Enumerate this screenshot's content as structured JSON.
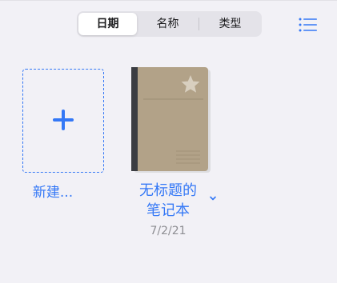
{
  "colors": {
    "background": "#f2f1f6",
    "accent": "#3478f6",
    "notebook_cover": "#b2a288",
    "notebook_spine": "#3b3d42",
    "secondary_text": "#8e8e93"
  },
  "sort_control": {
    "options": [
      {
        "label": "日期",
        "selected": true
      },
      {
        "label": "名称",
        "selected": false
      },
      {
        "label": "类型",
        "selected": false
      }
    ]
  },
  "toolbar": {
    "view_toggle_icon": "list-icon"
  },
  "items": {
    "new_tile": {
      "icon": "plus-icon",
      "label": "新建..."
    },
    "notebook": {
      "title_line1": "无标题的",
      "title_line2": "笔记本",
      "date": "7/2/21",
      "cover_icon": "star-icon",
      "menu_icon": "chevron-down-icon"
    }
  }
}
